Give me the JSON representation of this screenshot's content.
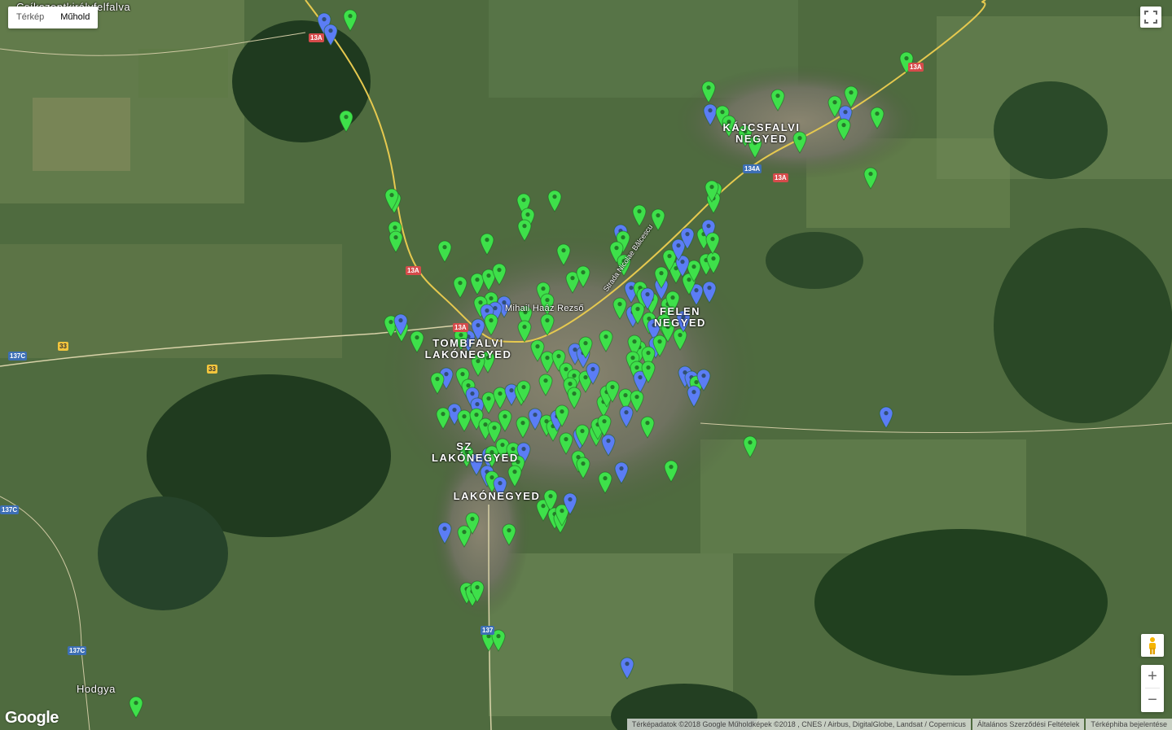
{
  "map_type_control": {
    "map_label": "Térkép",
    "satellite_label": "Műhold",
    "active": "satellite"
  },
  "place_labels": [
    {
      "text": "Csíkszentkirályfelfalva"
    },
    {
      "text": "KÁJCSFALVI NEGYED"
    },
    {
      "text": "FELEN NEGYED"
    },
    {
      "text": "TOMBFALVI LAKÓNEGYED"
    },
    {
      "text": "SZ LAKÓNEGYED"
    },
    {
      "text": "LAKÓNEGYED"
    },
    {
      "text": "Hodgya"
    },
    {
      "text": "Strada Nicolae Bălcescu"
    },
    {
      "text": "Mihail Haáz Rezső"
    }
  ],
  "road_signs": [
    {
      "text": "13A",
      "kind": "red"
    },
    {
      "text": "13A",
      "kind": "red"
    },
    {
      "text": "13A",
      "kind": "red"
    },
    {
      "text": "13A",
      "kind": "red"
    },
    {
      "text": "134A",
      "kind": "blue"
    },
    {
      "text": "13A",
      "kind": "red"
    },
    {
      "text": "33",
      "kind": "yellow"
    },
    {
      "text": "33",
      "kind": "yellow"
    },
    {
      "text": "137C",
      "kind": "blue"
    },
    {
      "text": "137C",
      "kind": "blue"
    },
    {
      "text": "137C",
      "kind": "blue"
    },
    {
      "text": "137",
      "kind": "blue"
    }
  ],
  "marker_colors": {
    "green": "#3ee04a",
    "blue": "#5b7df5"
  },
  "controls": {
    "zoom_in": "+",
    "zoom_out": "−",
    "fullscreen_icon": "fullscreen-icon",
    "pegman_icon": "pegman-icon"
  },
  "logo": "Google",
  "attribution": {
    "data": "Térképadatok ©2018 Google Műholdképek ©2018 , CNES / Airbus, DigitalGlobe, Landsat / Copernicus",
    "terms": "Általános Szerződési Feltételek",
    "report": "Térképhiba bejelentése"
  }
}
